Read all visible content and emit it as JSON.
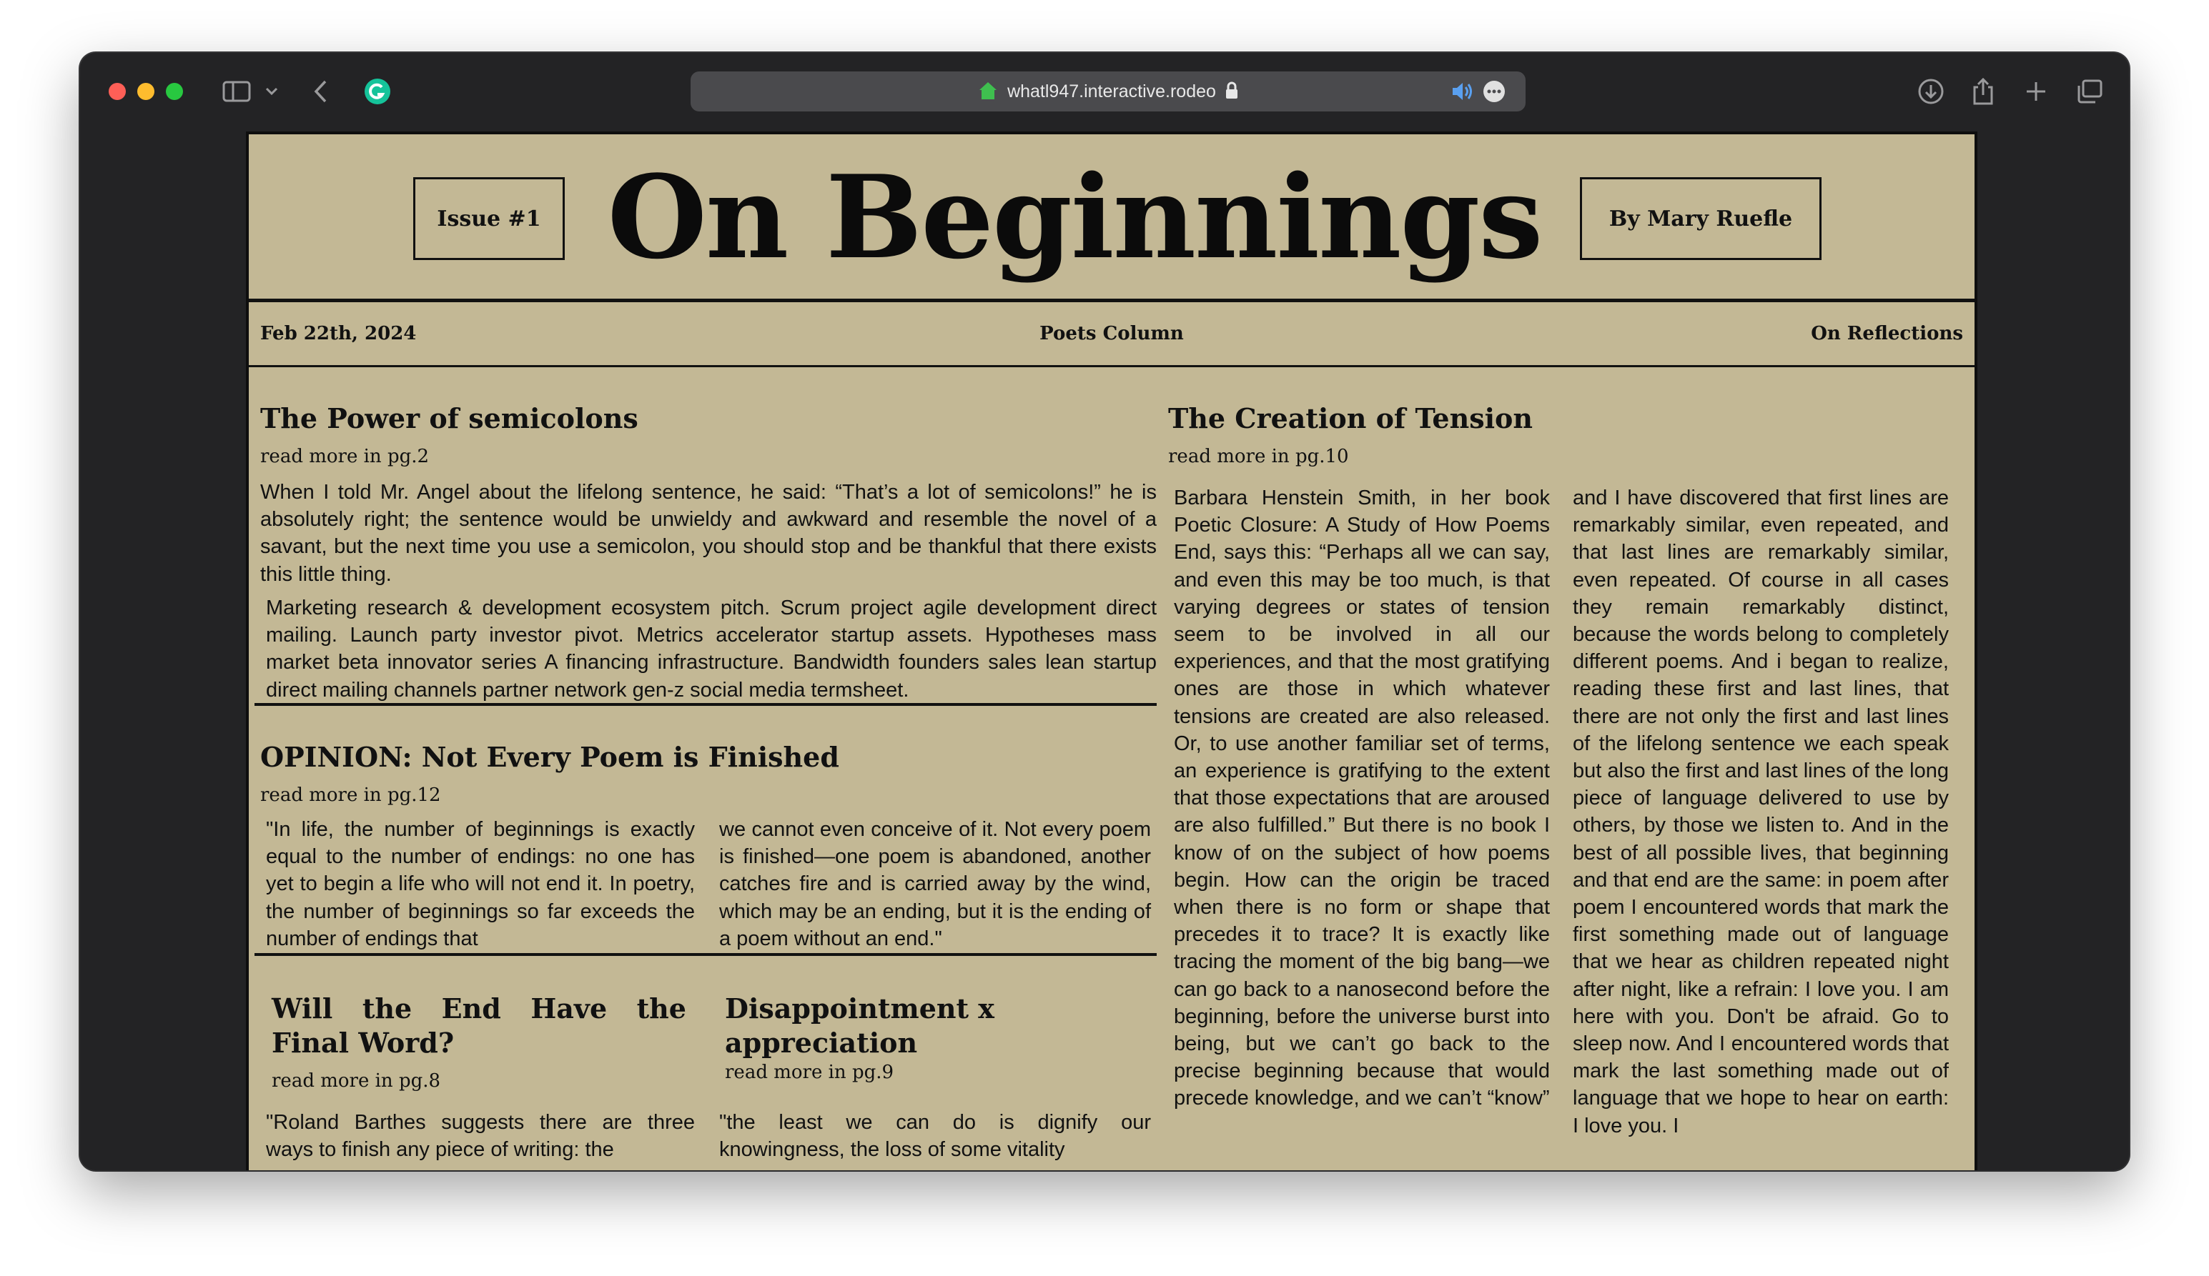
{
  "browser": {
    "url": "whatl947.interactive.rodeo"
  },
  "masthead": {
    "issue": "Issue #1",
    "title": "On Beginnings",
    "byline": "By Mary Ruefle"
  },
  "subbar": {
    "date": "Feb 22th, 2024",
    "section": "Poets Column",
    "right": "On Reflections"
  },
  "articles": {
    "semicolons": {
      "headline": "The Power of semicolons",
      "more": "read more in pg.2",
      "p1": "When I told Mr. Angel about the lifelong sentence, he said: “That’s a lot of semicolons!” he is absolutely right; the sentence would be unwieldy and awkward and resemble the novel of a savant, but the next time you use a semicolon, you should stop and be thankful that there exists this little thing.",
      "p2": "Marketing research & development ecosystem pitch. Scrum project agile development direct mailing. Launch party investor pivot. Metrics accelerator startup assets. Hypotheses mass market beta innovator series A financing infrastructure. Bandwidth founders sales lean startup direct mailing channels partner network gen-z social media termsheet."
    },
    "opinion": {
      "headline": "OPINION: Not Every Poem is Finished",
      "more": "read more in pg.12",
      "col1": "\"In life, the number of beginnings is exactly equal to the number of endings: no one has yet to begin a life who will not end it. In poetry, the number of beginnings so far exceeds the number of endings that",
      "col2": "we cannot even conceive of it. Not every poem is finished—one poem is abandoned, another catches fire and is carried away by the wind, which may be an ending, but it is the ending of a poem without an end.\""
    },
    "final_word": {
      "headline": "Will the End Have the Final Word?",
      "more": "read more in pg.8",
      "body": "\"Roland Barthes suggests there are three ways to finish any piece of writing: the"
    },
    "appreciation": {
      "headline": "Disappointment x appreciation",
      "more": "read more in pg.9",
      "body": "\"the least we can do is dignify our knowingness, the loss of some vitality"
    },
    "tension": {
      "headline": "The Creation of Tension",
      "more": "read more in pg.10",
      "col1": "Barbara Henstein Smith, in her book Poetic Closure: A Study of How Poems End, says this: “Perhaps all we can say, and even this may be too much, is that varying degrees or states of tension seem to be involved in all our experiences, and that the most gratifying ones are those in which whatever tensions are created are also released. Or, to use another familiar set of terms, an experience is gratifying to the extent that those expectations that are aroused are also fulfilled.” But there is no book I know of on the subject of how poems begin. How can the origin be traced when there is no form or shape that precedes it to trace? It is exactly like tracing the moment of the big bang—we can go back to a nanosecond before the beginning, before the universe burst into being, but we can’t go back to the precise beginning because that would precede knowledge, and we can’t “know”",
      "col2": "and I have discovered that first lines are remarkably similar, even repeated, and that last lines are remarkably similar, even repeated. Of course in all cases they remain remarkably distinct, because the words belong to completely different poems. And i began to realize, reading these first and last lines, that there are not only the first and last lines of the lifelong sentence we each speak but also the first and last lines of the long piece of language delivered to use by others, by those we listen to. And in the best of all possible lives, that beginning and that end are the same: in poem after poem I encountered words that mark the first something made out of language that we hear as children repeated night after night, like a refrain: I love you. I am here with you. Don't be afraid. Go to sleep now. And I encountered words that mark the last something made out of language that we hope to hear on earth: I love you. I"
    }
  }
}
